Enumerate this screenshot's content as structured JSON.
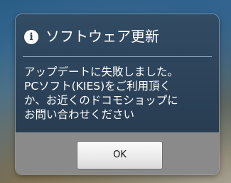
{
  "dialog": {
    "title": "ソフトウェア更新",
    "icon": "info-icon",
    "message_lines": [
      "アップデートに失敗しました。",
      "PCソフト(KIES)をご利用頂く",
      "か、お近くのドコモショップに",
      "お問い合わせください"
    ],
    "ok_label": "OK"
  }
}
